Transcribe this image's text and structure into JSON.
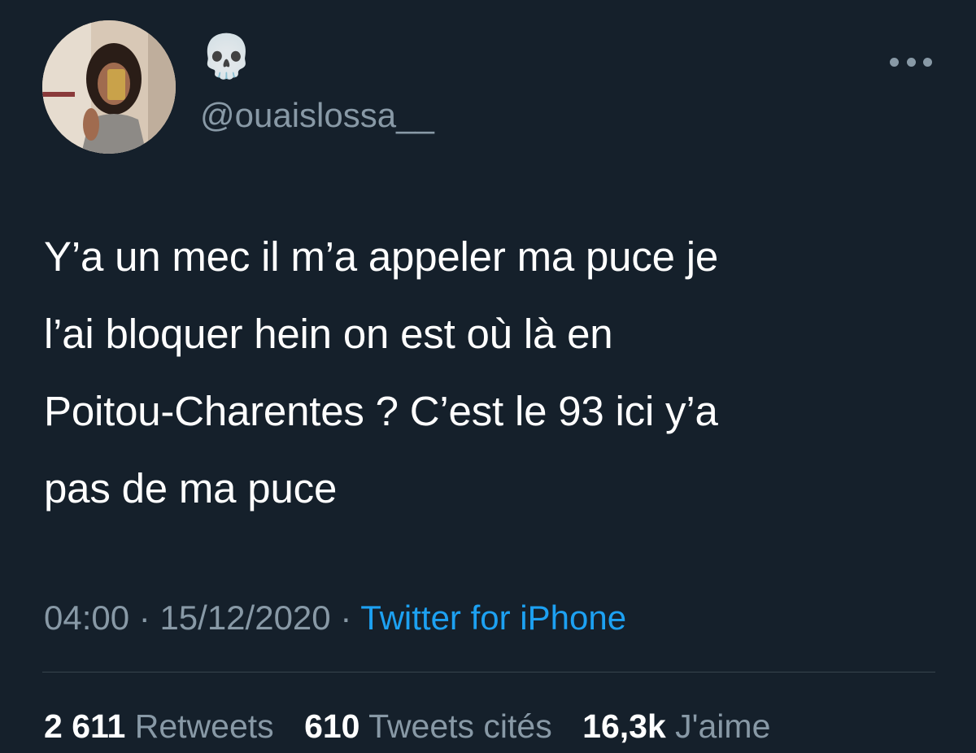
{
  "author": {
    "display_name": "💀",
    "handle": "@ouaislossa__"
  },
  "icons": {
    "more": "more-horizontal-icon",
    "avatar": "profile-photo"
  },
  "tweet": {
    "text": "Y’a un mec il m’a appeler ma puce je\nl’ai bloquer hein on est où là en\nPoitou-Charentes ? C’est le 93 ici y’a\npas de ma puce",
    "time": "04:00",
    "date": "15/12/2020",
    "separator": " · ",
    "source": "Twitter for iPhone"
  },
  "stats": {
    "retweets": {
      "count": "2 611",
      "label": "Retweets"
    },
    "quotes": {
      "count": "610",
      "label": "Tweets cités"
    },
    "likes": {
      "count": "16,3k",
      "label": "J'aime"
    }
  },
  "colors": {
    "background": "#15202b",
    "text": "#ffffff",
    "secondary": "#8899a6",
    "link": "#1da1f2",
    "divider": "#38444d"
  }
}
